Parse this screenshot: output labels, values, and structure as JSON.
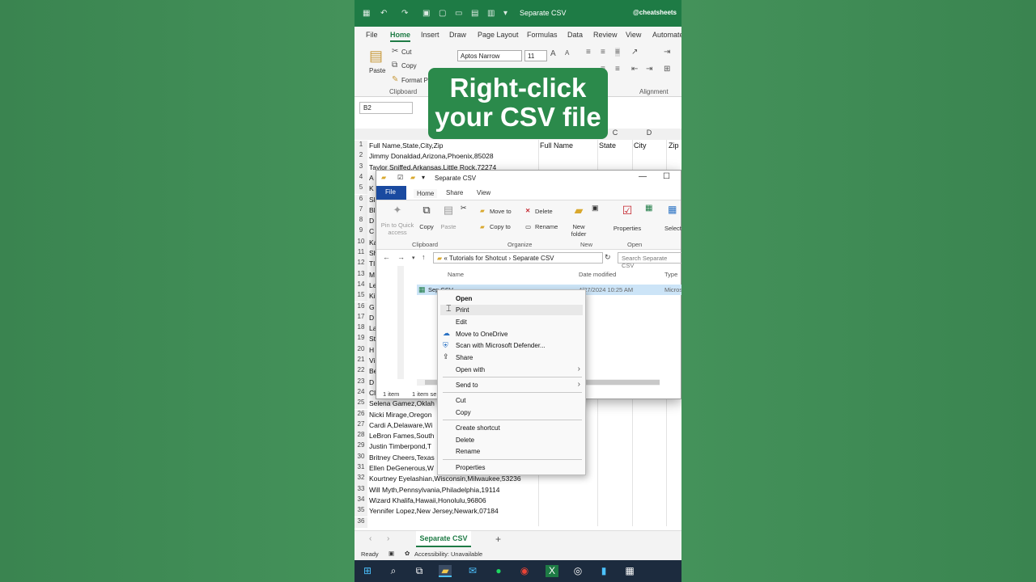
{
  "excel": {
    "doc_title": "Separate CSV",
    "handle": "@cheatsheets",
    "menu": [
      "File",
      "Home",
      "Insert",
      "Draw",
      "Page Layout",
      "Formulas",
      "Data",
      "Review",
      "View",
      "Automate"
    ],
    "ribbon": {
      "paste": "Paste",
      "cut": "Cut",
      "copy": "Copy",
      "format_painter": "Format Painter",
      "clipboard_group": "Clipboard",
      "font_name": "Aptos Narrow",
      "font_size": "11",
      "alignment_group": "Alignment"
    },
    "name_box": "B2",
    "columns": [
      "C",
      "D"
    ],
    "header_cells": [
      "Full Name",
      "State",
      "City",
      "Zip"
    ],
    "rows": [
      {
        "n": "1",
        "text": "Full Name,State,City,Zip"
      },
      {
        "n": "2",
        "text": "Jimmy Donaldad,Arizona,Phoenix,85028"
      },
      {
        "n": "3",
        "text": "Taylor Sniffed,Arkansas,Little Rock,72274"
      },
      {
        "n": "4",
        "text": "A"
      },
      {
        "n": "5",
        "text": "K"
      },
      {
        "n": "6",
        "text": "Sl"
      },
      {
        "n": "7",
        "text": "Bl"
      },
      {
        "n": "8",
        "text": "D"
      },
      {
        "n": "9",
        "text": "C"
      },
      {
        "n": "10",
        "text": "Ka"
      },
      {
        "n": "11",
        "text": "Sh"
      },
      {
        "n": "12",
        "text": "Tl"
      },
      {
        "n": "13",
        "text": "M"
      },
      {
        "n": "14",
        "text": "Le"
      },
      {
        "n": "15",
        "text": "Ki"
      },
      {
        "n": "16",
        "text": "G"
      },
      {
        "n": "17",
        "text": "D"
      },
      {
        "n": "18",
        "text": "La"
      },
      {
        "n": "19",
        "text": "St"
      },
      {
        "n": "20",
        "text": "H"
      },
      {
        "n": "21",
        "text": "Vi"
      },
      {
        "n": "22",
        "text": "Be"
      },
      {
        "n": "23",
        "text": "D"
      },
      {
        "n": "24",
        "text": "Cl"
      },
      {
        "n": "25",
        "text": "Selena Gamez,Oklah"
      },
      {
        "n": "26",
        "text": "Nicki Mirage,Oregon"
      },
      {
        "n": "27",
        "text": "Cardi A,Delaware,Wi"
      },
      {
        "n": "28",
        "text": "LeBron Fames,South"
      },
      {
        "n": "29",
        "text": "Justin Timberpond,T"
      },
      {
        "n": "30",
        "text": "Britney Cheers,Texas"
      },
      {
        "n": "31",
        "text": "Ellen DeGenerous,W"
      },
      {
        "n": "32",
        "text": "Kourtney Eyelashian,Wisconsin,Milwaukee,53236"
      },
      {
        "n": "33",
        "text": "Will Myth,Pennsylvania,Philadelphia,19114"
      },
      {
        "n": "34",
        "text": "Wizard Khalifa,Hawaii,Honolulu,96806"
      },
      {
        "n": "35",
        "text": "Yennifer Lopez,New Jersey,Newark,07184"
      },
      {
        "n": "36",
        "text": ""
      }
    ],
    "sheet_tab": "Separate CSV",
    "status": {
      "ready": "Ready",
      "accessibility": "Accessibility: Unavailable"
    }
  },
  "caption": {
    "line1": "Right-click",
    "line2": "your CSV file"
  },
  "explorer": {
    "title": "Separate CSV",
    "tabs": {
      "file": "File",
      "home": "Home",
      "share": "Share",
      "view": "View"
    },
    "ribbon": {
      "pin": "Pin to Quick access",
      "copy": "Copy",
      "paste": "Paste",
      "clipboard": "Clipboard",
      "move_to": "Move to",
      "copy_to": "Copy to",
      "delete": "Delete",
      "rename": "Rename",
      "organize": "Organize",
      "new_folder": "New folder",
      "new": "New",
      "properties": "Properties",
      "open": "Open",
      "select": "Select"
    },
    "breadcrumb": {
      "prefix": "«",
      "parent": "Tutorials for Shotcut",
      "current": "Separate CSV"
    },
    "search_placeholder": "Search Separate CSV",
    "columns": {
      "name": "Name",
      "date": "Date modified",
      "type": "Type"
    },
    "file": {
      "name": "Sep CSV",
      "date": "4/27/2024 10:25 AM",
      "type": "Microsoft Excel C"
    },
    "status": {
      "count": "1 item",
      "selected": "1 item se"
    }
  },
  "context_menu": {
    "items": [
      {
        "label": "Open",
        "bold": true
      },
      {
        "label": "Print"
      },
      {
        "label": "Edit"
      },
      {
        "label": "Move to OneDrive"
      },
      {
        "label": "Scan with Microsoft Defender..."
      },
      {
        "label": "Share"
      },
      {
        "label": "Open with"
      },
      {
        "label": "Send to"
      },
      {
        "label": "Cut"
      },
      {
        "label": "Copy"
      },
      {
        "label": "Create shortcut"
      },
      {
        "label": "Delete"
      },
      {
        "label": "Rename"
      },
      {
        "label": "Properties"
      }
    ]
  },
  "colors": {
    "excel_green": "#1e7b45",
    "caption_green": "#2b8a4b",
    "taskbar": "#1c2b3e",
    "selection": "#cce4f7"
  }
}
